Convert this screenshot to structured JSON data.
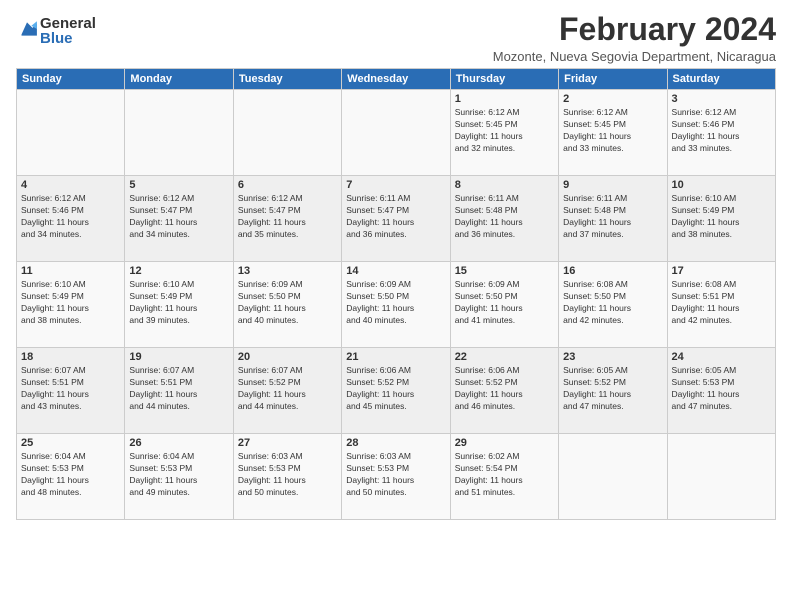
{
  "logo": {
    "general": "General",
    "blue": "Blue"
  },
  "title": "February 2024",
  "subtitle": "Mozonte, Nueva Segovia Department, Nicaragua",
  "headers": [
    "Sunday",
    "Monday",
    "Tuesday",
    "Wednesday",
    "Thursday",
    "Friday",
    "Saturday"
  ],
  "weeks": [
    [
      {
        "day": "",
        "info": ""
      },
      {
        "day": "",
        "info": ""
      },
      {
        "day": "",
        "info": ""
      },
      {
        "day": "",
        "info": ""
      },
      {
        "day": "1",
        "info": "Sunrise: 6:12 AM\nSunset: 5:45 PM\nDaylight: 11 hours\nand 32 minutes."
      },
      {
        "day": "2",
        "info": "Sunrise: 6:12 AM\nSunset: 5:45 PM\nDaylight: 11 hours\nand 33 minutes."
      },
      {
        "day": "3",
        "info": "Sunrise: 6:12 AM\nSunset: 5:46 PM\nDaylight: 11 hours\nand 33 minutes."
      }
    ],
    [
      {
        "day": "4",
        "info": "Sunrise: 6:12 AM\nSunset: 5:46 PM\nDaylight: 11 hours\nand 34 minutes."
      },
      {
        "day": "5",
        "info": "Sunrise: 6:12 AM\nSunset: 5:47 PM\nDaylight: 11 hours\nand 34 minutes."
      },
      {
        "day": "6",
        "info": "Sunrise: 6:12 AM\nSunset: 5:47 PM\nDaylight: 11 hours\nand 35 minutes."
      },
      {
        "day": "7",
        "info": "Sunrise: 6:11 AM\nSunset: 5:47 PM\nDaylight: 11 hours\nand 36 minutes."
      },
      {
        "day": "8",
        "info": "Sunrise: 6:11 AM\nSunset: 5:48 PM\nDaylight: 11 hours\nand 36 minutes."
      },
      {
        "day": "9",
        "info": "Sunrise: 6:11 AM\nSunset: 5:48 PM\nDaylight: 11 hours\nand 37 minutes."
      },
      {
        "day": "10",
        "info": "Sunrise: 6:10 AM\nSunset: 5:49 PM\nDaylight: 11 hours\nand 38 minutes."
      }
    ],
    [
      {
        "day": "11",
        "info": "Sunrise: 6:10 AM\nSunset: 5:49 PM\nDaylight: 11 hours\nand 38 minutes."
      },
      {
        "day": "12",
        "info": "Sunrise: 6:10 AM\nSunset: 5:49 PM\nDaylight: 11 hours\nand 39 minutes."
      },
      {
        "day": "13",
        "info": "Sunrise: 6:09 AM\nSunset: 5:50 PM\nDaylight: 11 hours\nand 40 minutes."
      },
      {
        "day": "14",
        "info": "Sunrise: 6:09 AM\nSunset: 5:50 PM\nDaylight: 11 hours\nand 40 minutes."
      },
      {
        "day": "15",
        "info": "Sunrise: 6:09 AM\nSunset: 5:50 PM\nDaylight: 11 hours\nand 41 minutes."
      },
      {
        "day": "16",
        "info": "Sunrise: 6:08 AM\nSunset: 5:50 PM\nDaylight: 11 hours\nand 42 minutes."
      },
      {
        "day": "17",
        "info": "Sunrise: 6:08 AM\nSunset: 5:51 PM\nDaylight: 11 hours\nand 42 minutes."
      }
    ],
    [
      {
        "day": "18",
        "info": "Sunrise: 6:07 AM\nSunset: 5:51 PM\nDaylight: 11 hours\nand 43 minutes."
      },
      {
        "day": "19",
        "info": "Sunrise: 6:07 AM\nSunset: 5:51 PM\nDaylight: 11 hours\nand 44 minutes."
      },
      {
        "day": "20",
        "info": "Sunrise: 6:07 AM\nSunset: 5:52 PM\nDaylight: 11 hours\nand 44 minutes."
      },
      {
        "day": "21",
        "info": "Sunrise: 6:06 AM\nSunset: 5:52 PM\nDaylight: 11 hours\nand 45 minutes."
      },
      {
        "day": "22",
        "info": "Sunrise: 6:06 AM\nSunset: 5:52 PM\nDaylight: 11 hours\nand 46 minutes."
      },
      {
        "day": "23",
        "info": "Sunrise: 6:05 AM\nSunset: 5:52 PM\nDaylight: 11 hours\nand 47 minutes."
      },
      {
        "day": "24",
        "info": "Sunrise: 6:05 AM\nSunset: 5:53 PM\nDaylight: 11 hours\nand 47 minutes."
      }
    ],
    [
      {
        "day": "25",
        "info": "Sunrise: 6:04 AM\nSunset: 5:53 PM\nDaylight: 11 hours\nand 48 minutes."
      },
      {
        "day": "26",
        "info": "Sunrise: 6:04 AM\nSunset: 5:53 PM\nDaylight: 11 hours\nand 49 minutes."
      },
      {
        "day": "27",
        "info": "Sunrise: 6:03 AM\nSunset: 5:53 PM\nDaylight: 11 hours\nand 50 minutes."
      },
      {
        "day": "28",
        "info": "Sunrise: 6:03 AM\nSunset: 5:53 PM\nDaylight: 11 hours\nand 50 minutes."
      },
      {
        "day": "29",
        "info": "Sunrise: 6:02 AM\nSunset: 5:54 PM\nDaylight: 11 hours\nand 51 minutes."
      },
      {
        "day": "",
        "info": ""
      },
      {
        "day": "",
        "info": ""
      }
    ]
  ]
}
